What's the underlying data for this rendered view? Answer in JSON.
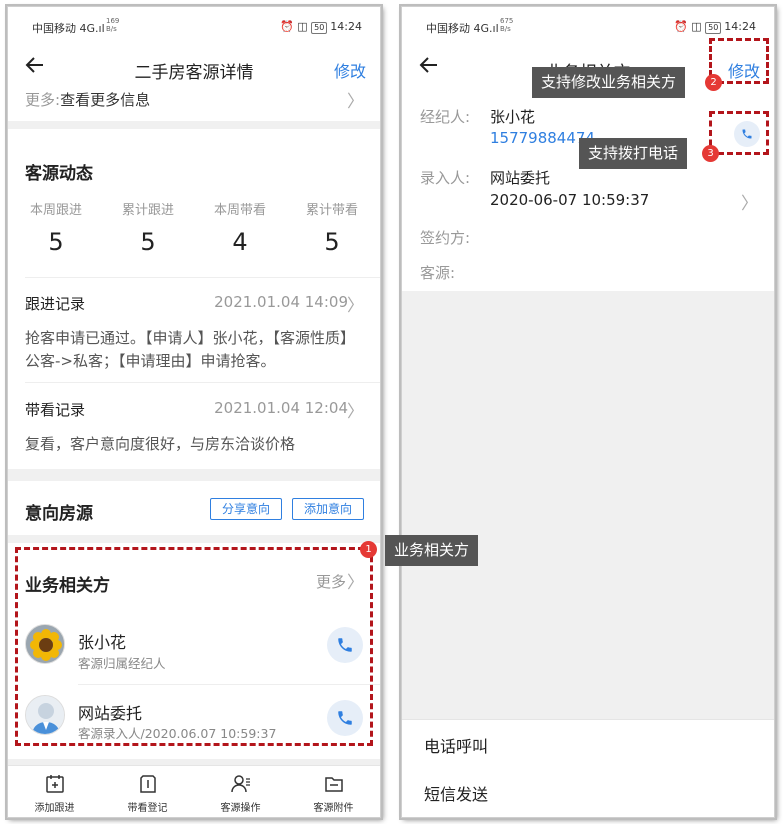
{
  "screen1": {
    "status": {
      "carrier": "中国移动",
      "signal": "4G",
      "speed_value": "169",
      "speed_unit": "B/s",
      "battery": "50",
      "time": "14:24"
    },
    "nav": {
      "title": "二手房客源详情",
      "edit": "修改"
    },
    "more_row": {
      "label": "更多:",
      "value": "查看更多信息"
    },
    "dynamics": {
      "title": "客源动态",
      "stats": [
        {
          "label": "本周跟进",
          "value": "5"
        },
        {
          "label": "累计跟进",
          "value": "5"
        },
        {
          "label": "本周带看",
          "value": "4"
        },
        {
          "label": "累计带看",
          "value": "5"
        }
      ],
      "follow_record": {
        "title": "跟进记录",
        "date": "2021.01.04 14:09",
        "text": "抢客申请已通过。【申请人】张小花，【客源性质】公客->私客；【申请理由】申请抢客。"
      },
      "viewing_record": {
        "title": "带看记录",
        "date": "2021.01.04 12:04",
        "text": "复看，客户意向度很好，与房东洽谈价格"
      }
    },
    "intent": {
      "title": "意向房源",
      "share": "分享意向",
      "add": "添加意向"
    },
    "parties": {
      "title": "业务相关方",
      "more": "更多",
      "people": [
        {
          "name": "张小花",
          "sub": "客源归属经纪人"
        },
        {
          "name": "网站委托",
          "sub": "客源录入人/2020.06.07 10:59:37"
        }
      ]
    },
    "tabbar": [
      {
        "label": "添加跟进",
        "icon": "add-follow-icon"
      },
      {
        "label": "带看登记",
        "icon": "viewing-register-icon"
      },
      {
        "label": "客源操作",
        "icon": "client-operation-icon"
      },
      {
        "label": "客源附件",
        "icon": "folder-icon"
      }
    ]
  },
  "screen2": {
    "status": {
      "carrier": "中国移动",
      "signal": "4G",
      "speed_value": "675",
      "speed_unit": "B/s",
      "battery": "50",
      "time": "14:24"
    },
    "nav": {
      "title": "业务相关方",
      "edit": "修改"
    },
    "fields": {
      "agent_label": "经纪人:",
      "agent_name": "张小花",
      "agent_phone": "15779884474",
      "entry_label": "录入人:",
      "entry_name": "网站委托",
      "entry_time": "2020-06-07 10:59:37",
      "signer_label": "签约方:",
      "source_label": "客源:"
    },
    "sheet": {
      "call": "电话呼叫",
      "sms": "短信发送"
    }
  },
  "annotations": [
    {
      "number": "1",
      "text": "业务相关方"
    },
    {
      "number": "2",
      "text": "支持修改业务相关方"
    },
    {
      "number": "3",
      "text": "支持拨打电话"
    }
  ],
  "colors": {
    "accent": "#2f7fe0",
    "annotation_dash": "#b3151b",
    "badge": "#e53935",
    "tooltip": "#555555"
  }
}
